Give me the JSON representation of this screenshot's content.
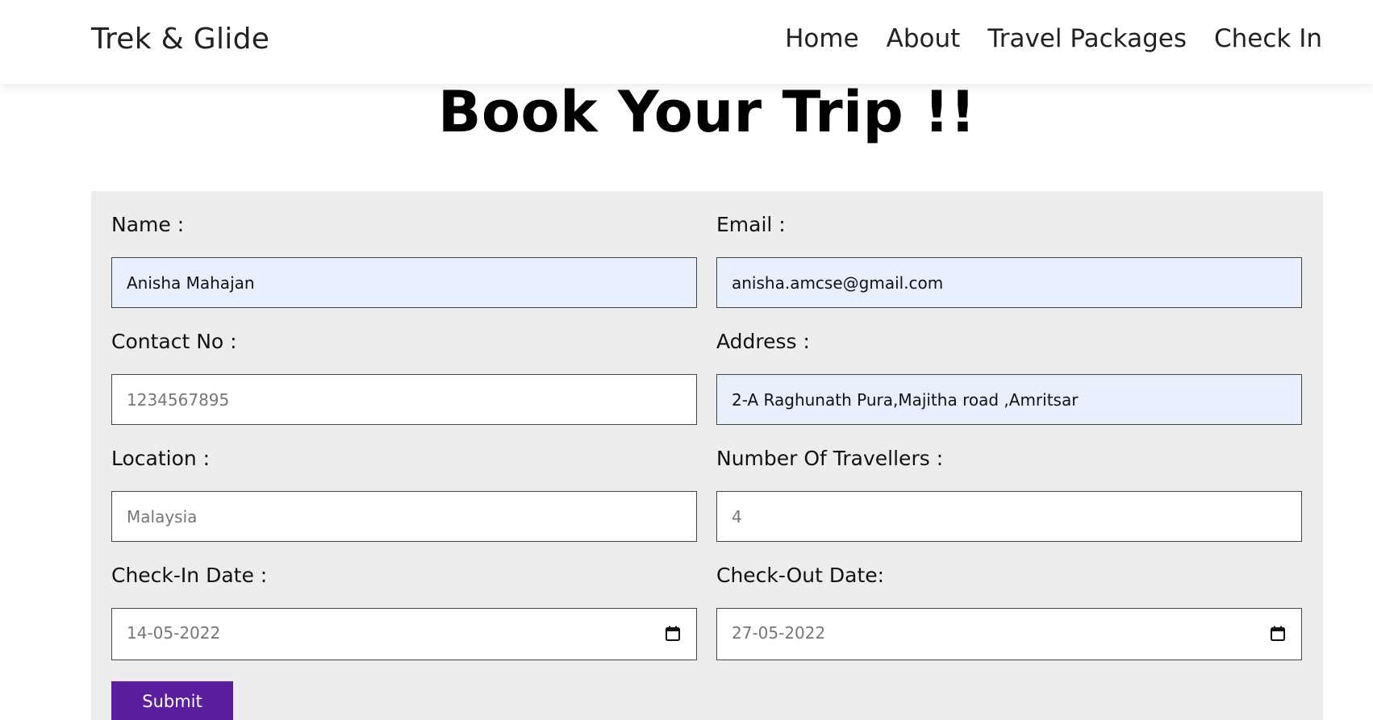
{
  "nav": {
    "brand": "Trek & Glide",
    "links": [
      "Home",
      "About",
      "Travel Packages",
      "Check In"
    ]
  },
  "page": {
    "title": "Book Your Trip !!"
  },
  "form": {
    "name": {
      "label": "Name :",
      "value": "Anisha Mahajan"
    },
    "email": {
      "label": "Email :",
      "value": "anisha.amcse@gmail.com"
    },
    "contact": {
      "label": "Contact No :",
      "placeholder": "1234567895"
    },
    "address": {
      "label": "Address :",
      "value": "2-A Raghunath Pura,Majitha road ,Amritsar"
    },
    "location": {
      "label": "Location :",
      "placeholder": "Malaysia"
    },
    "travellers": {
      "label": "Number Of Travellers :",
      "placeholder": "4"
    },
    "checkin": {
      "label": "Check-In Date :",
      "value": "14-05-2022"
    },
    "checkout": {
      "label": "Check-Out Date:",
      "value": "27-05-2022"
    },
    "submit_label": "Submit"
  },
  "colors": {
    "submit_bg": "#5b1ea1",
    "panel_bg": "#ededed",
    "autofill_bg": "#e8f0fe"
  },
  "icons": {
    "date_picker": "calendar-icon"
  }
}
